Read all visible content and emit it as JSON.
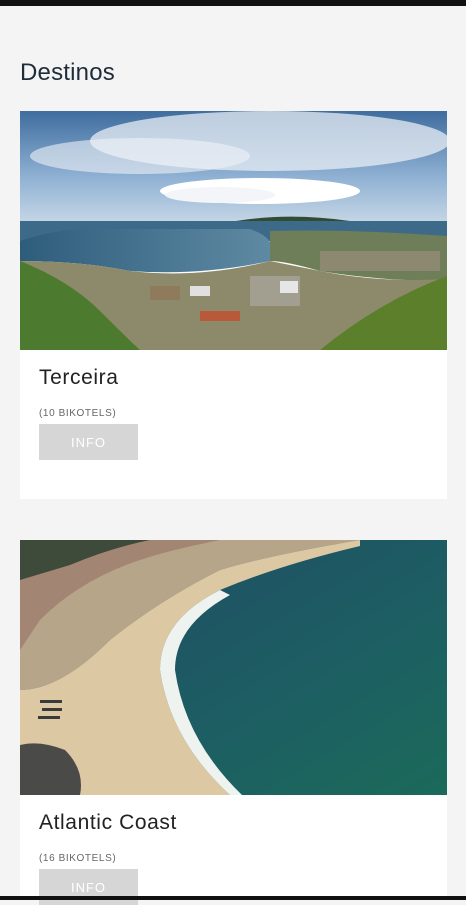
{
  "header": {
    "title": "Destinos"
  },
  "destinations": [
    {
      "name": "Terceira",
      "count": "(10 BIKOTELS)",
      "button_label": "INFO"
    },
    {
      "name": "Atlantic Coast",
      "count": "(16 BIKOTELS)",
      "button_label": "INFO"
    }
  ]
}
